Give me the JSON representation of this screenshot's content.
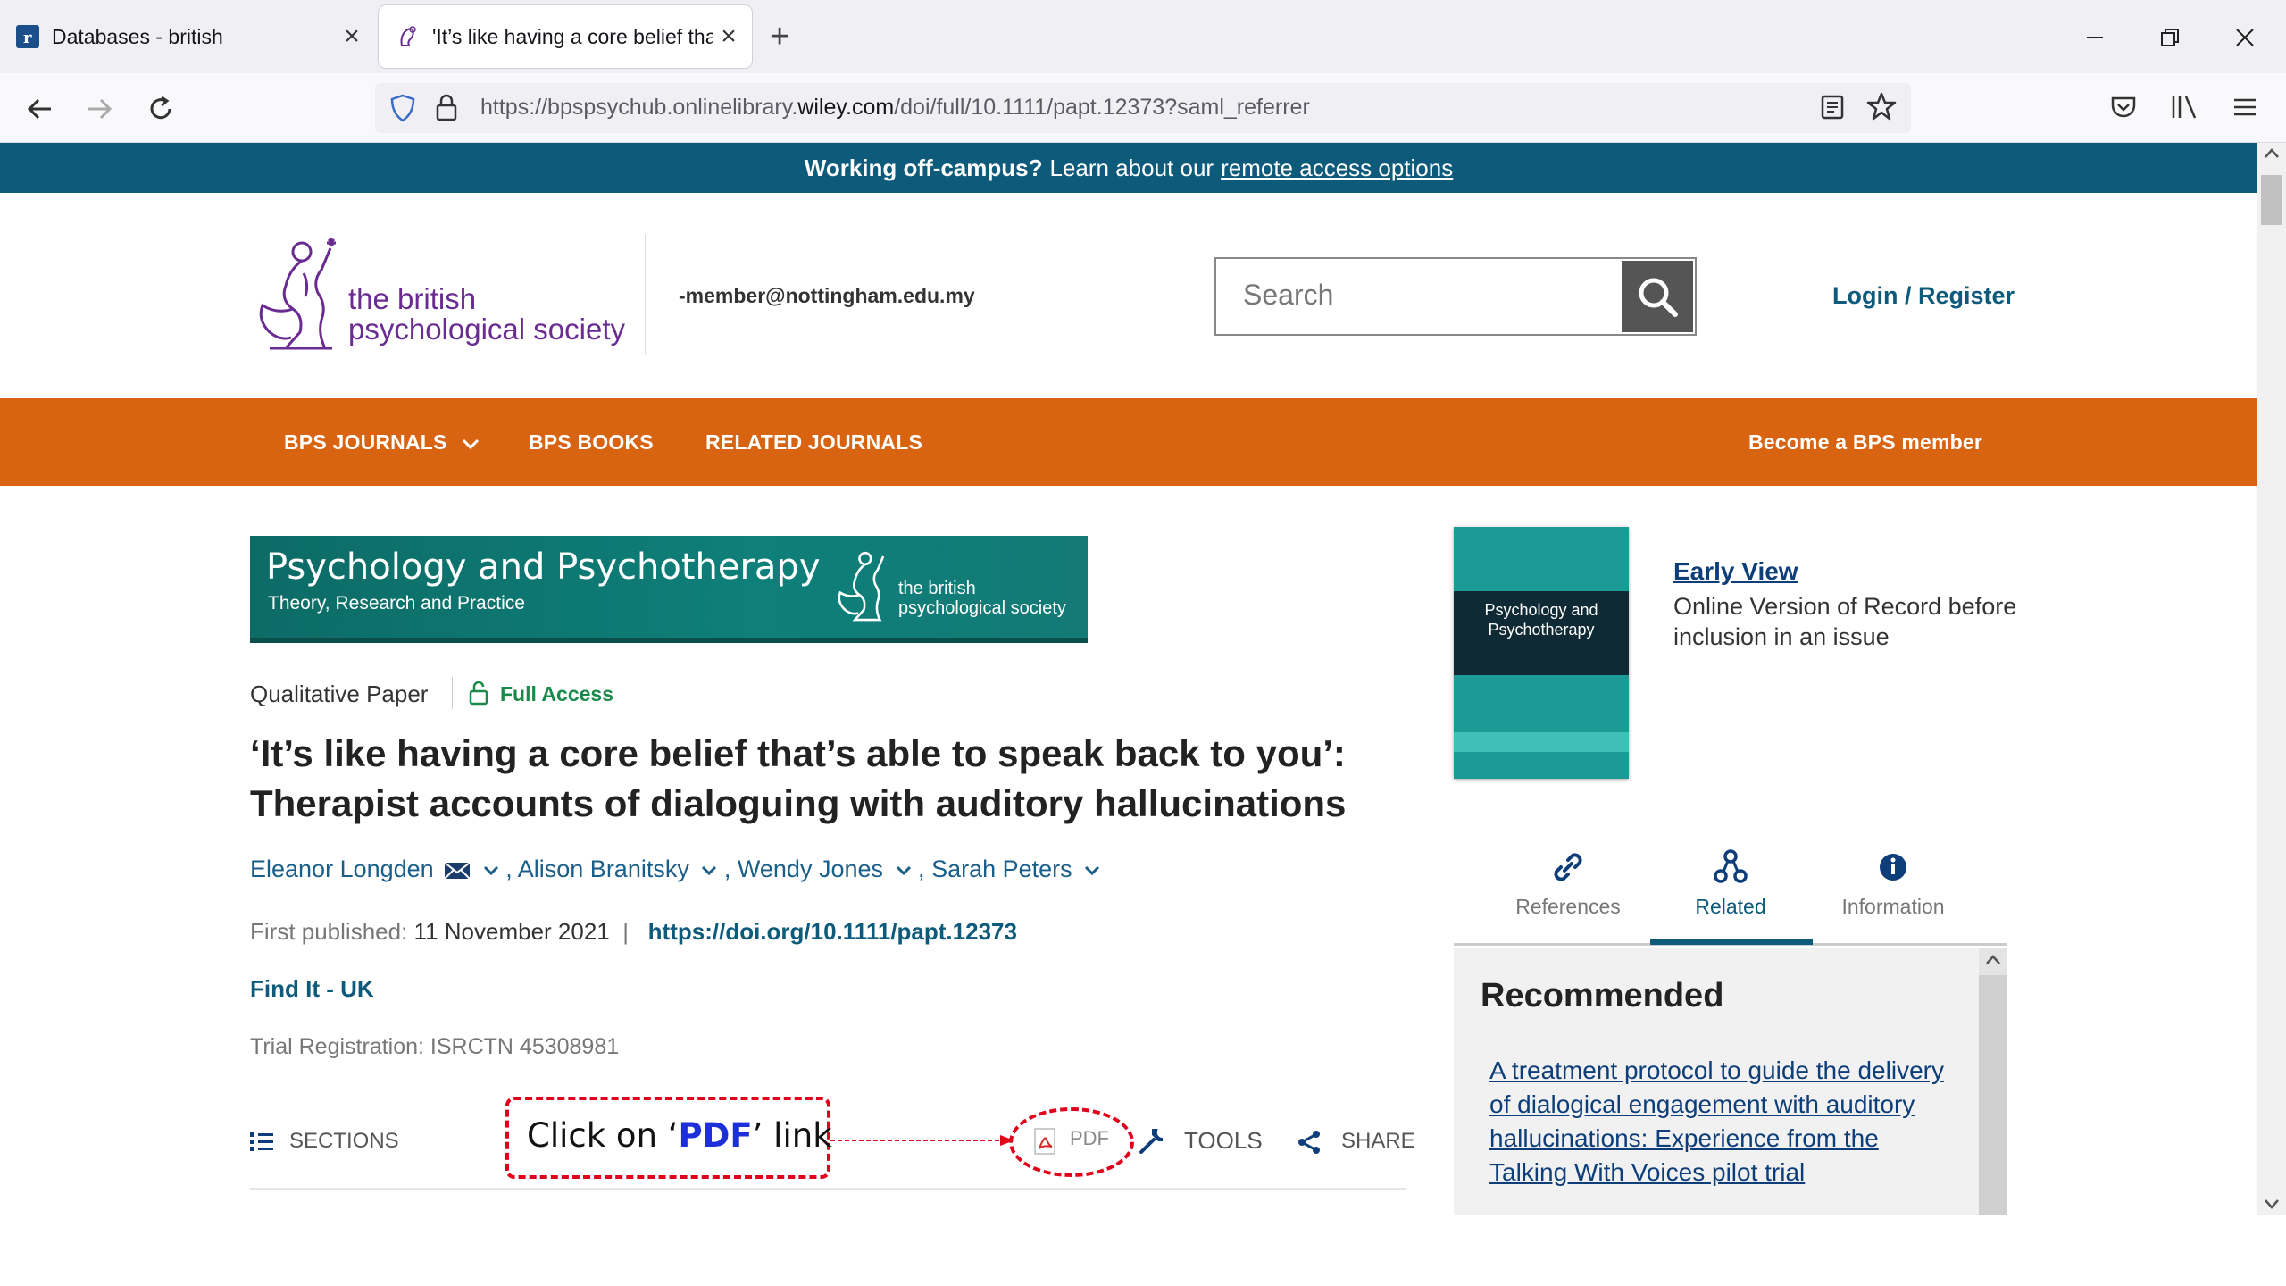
{
  "browser": {
    "tabs": [
      {
        "title": "Databases - british",
        "active": false
      },
      {
        "title": "'It’s like having a core belief tha",
        "active": true
      }
    ],
    "url_prefix": "https://bpspsychub.onlinelibrary.",
    "url_domain": "wiley.com",
    "url_suffix": "/doi/full/10.1111/papt.12373?saml_referrer"
  },
  "banner": {
    "bold": "Working off-campus?",
    "text": "Learn about our",
    "link": "remote access options"
  },
  "header": {
    "logo_line1": "the british",
    "logo_line2": "psychological society",
    "member": "-member@nottingham.edu.my",
    "search_placeholder": "Search",
    "login": "Login / Register"
  },
  "orange_nav": {
    "items": [
      "BPS JOURNALS",
      "BPS BOOKS",
      "RELATED JOURNALS"
    ],
    "right": "Become a BPS member"
  },
  "journal_banner": {
    "title": "Psychology and Psychotherapy",
    "subtitle": "Theory, Research and Practice",
    "society_line1": "the british",
    "society_line2": "psychological society"
  },
  "article": {
    "type": "Qualitative Paper",
    "access": "Full Access",
    "title": "‘It’s like having a core belief that’s able to speak back to you’: Therapist accounts of dialoguing with auditory hallucinations",
    "authors": [
      "Eleanor Longden",
      "Alison Branitsky",
      "Wendy Jones",
      "Sarah Peters"
    ],
    "first_published_label": "First published:",
    "first_published_date": "11 November 2021",
    "doi": "https://doi.org/10.1111/papt.12373",
    "find_it": "Find It - UK",
    "trial": "Trial Registration: ISRCTN 45308981"
  },
  "toolbar": {
    "sections": "SECTIONS",
    "pdf": "PDF",
    "tools": "TOOLS",
    "share": "SHARE"
  },
  "annotation": {
    "pre": "Click on ‘",
    "highlight": "PDF",
    "post": "’ link"
  },
  "sidebar": {
    "cover_title": "Psychology and Psychotherapy",
    "early_view": "Early View",
    "early_desc": "Online Version of Record before inclusion in an issue",
    "tabs": [
      "References",
      "Related",
      "Information"
    ],
    "active_tab": "Related",
    "recommended_title": "Recommended",
    "recommended_link": "A treatment protocol to guide the delivery of dialogical engagement with auditory hallucinations: Experience from the Talking With Voices pilot trial"
  }
}
